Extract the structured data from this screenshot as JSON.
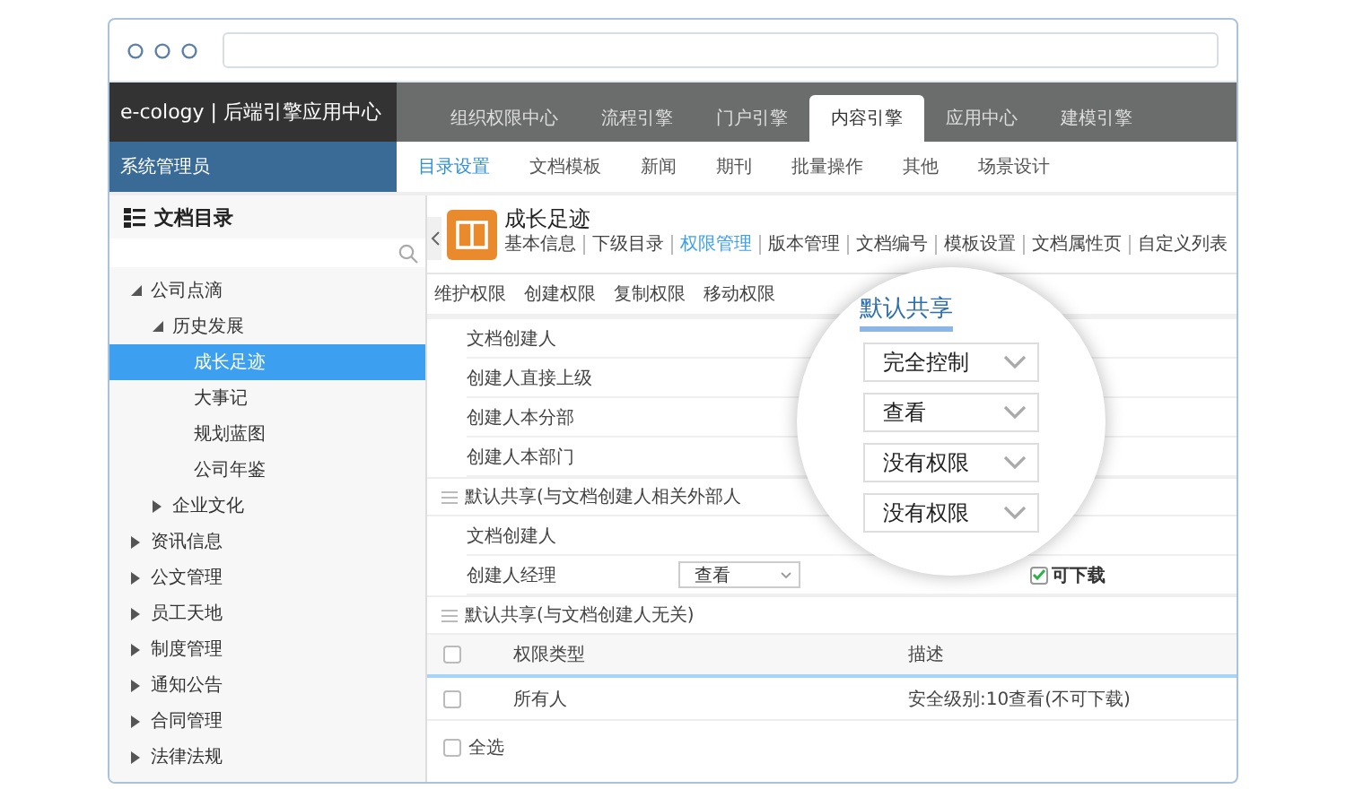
{
  "app_header": {
    "brand": "e-cology | 后端引擎应用中心",
    "tabs": [
      {
        "label": "组织权限中心",
        "selected": false
      },
      {
        "label": "流程引擎",
        "selected": false
      },
      {
        "label": "门户引擎",
        "selected": false
      },
      {
        "label": "内容引擎",
        "selected": true
      },
      {
        "label": "应用中心",
        "selected": false
      },
      {
        "label": "建模引擎",
        "selected": false
      }
    ]
  },
  "user_bar": {
    "user": "系统管理员",
    "nav": [
      {
        "label": "目录设置",
        "selected": true
      },
      {
        "label": "文档模板",
        "selected": false
      },
      {
        "label": "新闻",
        "selected": false
      },
      {
        "label": "期刊",
        "selected": false
      },
      {
        "label": "批量操作",
        "selected": false
      },
      {
        "label": "其他",
        "selected": false
      },
      {
        "label": "场景设计",
        "selected": false
      }
    ]
  },
  "sidebar": {
    "title": "文档目录",
    "tree": [
      {
        "label": "公司点滴",
        "selected": false,
        "expanded": true,
        "children": [
          {
            "label": "历史发展",
            "selected": false,
            "expanded": true,
            "children": [
              {
                "label": "成长足迹",
                "selected": true
              },
              {
                "label": "大事记",
                "selected": false
              },
              {
                "label": "规划蓝图",
                "selected": false
              },
              {
                "label": "公司年鉴",
                "selected": false
              }
            ]
          },
          {
            "label": "企业文化",
            "selected": false,
            "expanded": false
          }
        ]
      },
      {
        "label": "资讯信息",
        "selected": false,
        "expanded": false
      },
      {
        "label": "公文管理",
        "selected": false,
        "expanded": false
      },
      {
        "label": "员工天地",
        "selected": false,
        "expanded": false
      },
      {
        "label": "制度管理",
        "selected": false,
        "expanded": false
      },
      {
        "label": "通知公告",
        "selected": false,
        "expanded": false
      },
      {
        "label": "合同管理",
        "selected": false,
        "expanded": false
      },
      {
        "label": "法律法规",
        "selected": false,
        "expanded": false
      }
    ]
  },
  "content": {
    "title": "成长足迹",
    "tabs": [
      {
        "label": "基本信息",
        "selected": false
      },
      {
        "label": "下级目录",
        "selected": false
      },
      {
        "label": "权限管理",
        "selected": true
      },
      {
        "label": "版本管理",
        "selected": false
      },
      {
        "label": "文档编号",
        "selected": false
      },
      {
        "label": "模板设置",
        "selected": false
      },
      {
        "label": "文档属性页",
        "selected": false
      },
      {
        "label": "自定义列表",
        "selected": false
      }
    ],
    "permission_tabs": [
      {
        "label": "维护权限",
        "selected": false
      },
      {
        "label": "创建权限",
        "selected": false
      },
      {
        "label": "复制权限",
        "selected": false
      },
      {
        "label": "移动权限",
        "selected": false
      }
    ],
    "rows": [
      {
        "label": "文档创建人"
      },
      {
        "label": "创建人直接上级"
      },
      {
        "label": "创建人本分部"
      },
      {
        "label": "创建人本部门"
      }
    ],
    "external_section": {
      "title": "默认共享(与文档创建人相关外部人",
      "rows": [
        {
          "label": "文档创建人"
        },
        {
          "label": "创建人经理",
          "select": "查看",
          "download": {
            "label": "可下载",
            "checked": true
          }
        }
      ]
    },
    "unrelated_section": {
      "title": "默认共享(与文档创建人无关)",
      "header_checked": false,
      "columns": [
        "权限类型",
        "描述"
      ],
      "rows": [
        {
          "checked": false,
          "cells": [
            "所有人",
            "安全级别:10查看(不可下载)"
          ]
        }
      ]
    },
    "select_all": {
      "label": "全选",
      "checked": false
    }
  },
  "magnifier": {
    "tab": {
      "label": "默认共享",
      "selected": true
    },
    "selects": [
      "完全控制",
      "查看",
      "没有权限",
      "没有权限"
    ]
  }
}
